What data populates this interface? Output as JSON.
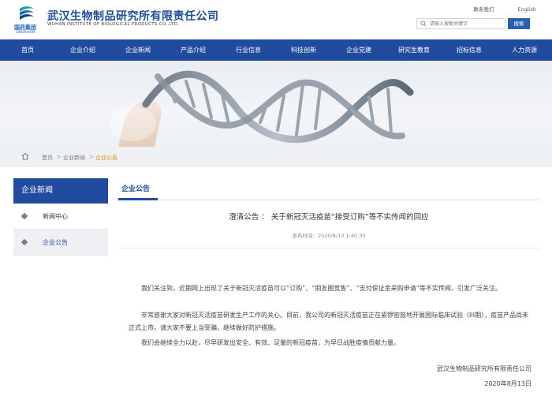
{
  "header": {
    "logo_text": "国药集团",
    "logo_sub": "SINOPHARM",
    "company_cn": "武汉生物制品研究所有限责任公司",
    "company_en": "WUHAN INSTITUTE OF BIOLOGICAL PRODUCTS CO.,LTD.",
    "contact_label": "联系我们",
    "english_label": "English",
    "search_placeholder": "请输入搜索关键字",
    "search_button": "搜索"
  },
  "nav": {
    "items": [
      "首页",
      "企业介绍",
      "企业新闻",
      "产品介绍",
      "行业信息",
      "科技创新",
      "企业党建",
      "研究生教育",
      "招标信息",
      "人力资源"
    ]
  },
  "breadcrumb": {
    "items": [
      "首页",
      "企业新闻",
      "企业公告"
    ]
  },
  "sidebar": {
    "title": "企业新闻",
    "items": [
      {
        "label": "新闻中心",
        "active": false
      },
      {
        "label": "企业公告",
        "active": true
      }
    ]
  },
  "content": {
    "tab": "企业公告",
    "title": "澄清公告 ： 关于新冠灭活疫苗“接受订购”等不实传闻的回应",
    "meta": "发布时间：2020/8/13 1:40:30",
    "paragraphs": [
      "我们关注到，近期网上出现了关于新冠灭活疫苗可以“订购”、“朋友圈竞售”、“支付保证金采购申请”等不实传闻，引发广泛关注。",
      "非常感谢大家对新冠灭活疫苗研发生产工作的关心。目前，我公司的新冠灭活疫苗正在紧锣密鼓地开展国际临床试验（III期），疫苗产品尚未正式上市。请大家不要上当受骗，继续做好防护措施。",
      "我们会继续全力以赴，尽早研发出安全、有效、足量的新冠疫苗，为早日战胜疫情贡献力量。"
    ],
    "signature": "武汉生物制品研究所有限责任公司",
    "date": "2020年8月13日"
  },
  "colors": {
    "brand_blue": "#204b9f",
    "accent_gold": "#c8921d"
  }
}
